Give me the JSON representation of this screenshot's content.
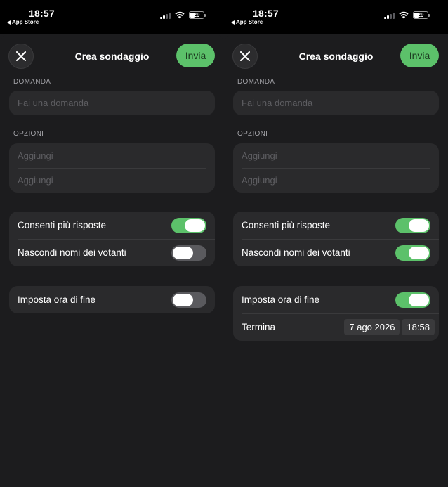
{
  "screens": [
    {
      "status": {
        "time": "18:57",
        "back_app": "App Store",
        "battery": "29"
      },
      "header": {
        "title": "Crea sondaggio",
        "send_label": "Invia"
      },
      "question": {
        "section_label": "DOMANDA",
        "placeholder": "Fai una domanda"
      },
      "options": {
        "section_label": "OPZIONI",
        "placeholders": [
          "Aggiungi",
          "Aggiungi"
        ]
      },
      "settings": [
        {
          "label": "Consenti più risposte",
          "on": true
        },
        {
          "label": "Nascondi nomi dei votanti",
          "on": false
        }
      ],
      "end_time": {
        "label": "Imposta ora di fine",
        "on": false
      }
    },
    {
      "status": {
        "time": "18:57",
        "back_app": "App Store",
        "battery": "29"
      },
      "header": {
        "title": "Crea sondaggio",
        "send_label": "Invia"
      },
      "question": {
        "section_label": "DOMANDA",
        "placeholder": "Fai una domanda"
      },
      "options": {
        "section_label": "OPZIONI",
        "placeholders": [
          "Aggiungi",
          "Aggiungi"
        ]
      },
      "settings": [
        {
          "label": "Consenti più risposte",
          "on": true
        },
        {
          "label": "Nascondi nomi dei votanti",
          "on": true
        }
      ],
      "end_time": {
        "label": "Imposta ora di fine",
        "on": true,
        "ends_label": "Termina",
        "date": "7 ago 2026",
        "time": "18:58"
      }
    }
  ],
  "colors": {
    "accent_green": "#5cc16a",
    "background": "#1c1c1e",
    "card": "#2a2a2c",
    "toggle_off": "#5a5a5e"
  }
}
